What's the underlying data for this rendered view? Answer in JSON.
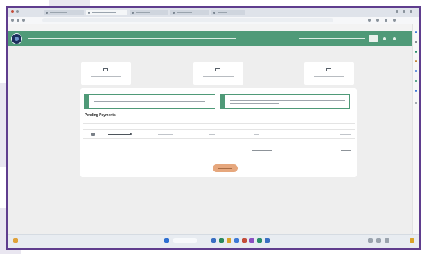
{
  "app_header": {
    "title": "",
    "user_name": ""
  },
  "tiles": [
    {
      "label": ""
    },
    {
      "label": ""
    },
    {
      "label": ""
    }
  ],
  "alerts": [
    {
      "badge": "",
      "text": ""
    },
    {
      "badge": "",
      "text": ""
    }
  ],
  "pending_payments": {
    "heading": "Pending Payments",
    "columns": [
      "",
      "",
      "",
      "",
      "",
      ""
    ],
    "rows": [
      {
        "cells": [
          "",
          "",
          "",
          "",
          "",
          ""
        ]
      }
    ],
    "total_label": "",
    "total_value": ""
  },
  "proceed_button": {
    "label": ""
  },
  "colors": {
    "brand_green": "#4f9a78",
    "frame_purple": "#5f3d8e",
    "button_orange": "#e6a77d"
  }
}
